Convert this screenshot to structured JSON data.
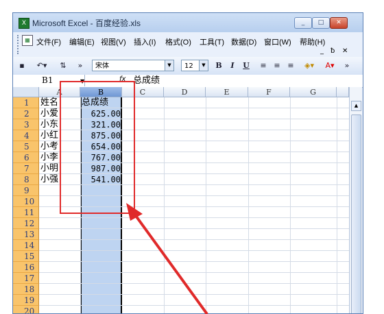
{
  "window": {
    "title": "Microsoft Excel - 百度经验.xls",
    "icon": "excel-icon"
  },
  "menu": [
    "文件(F)",
    "编辑(E)",
    "视图(V)",
    "插入(I)",
    "格式(O)",
    "工具(T)",
    "数据(D)",
    "窗口(W)",
    "帮助(H)"
  ],
  "toolbar": {
    "font": "宋体",
    "size": "12",
    "bold": "B",
    "italic": "I",
    "underline": "U"
  },
  "formula_bar": {
    "name_box": "B1",
    "fx": "fx",
    "content": "总成绩"
  },
  "columns": [
    "A",
    "B",
    "C",
    "D",
    "E",
    "F",
    "G"
  ],
  "rows": [
    "1",
    "2",
    "3",
    "4",
    "5",
    "6",
    "7",
    "8",
    "9",
    "10",
    "11",
    "12",
    "13",
    "14",
    "15",
    "16",
    "17",
    "18",
    "19",
    "20"
  ],
  "cells": [
    [
      "姓名",
      "总成绩"
    ],
    [
      "小爱",
      "625.00"
    ],
    [
      "小东",
      "321.00"
    ],
    [
      "小红",
      "875.00"
    ],
    [
      "小考",
      "654.00"
    ],
    [
      "小李",
      "767.00"
    ],
    [
      "小明",
      "987.00"
    ],
    [
      "小强",
      "541.00"
    ]
  ],
  "colors": {
    "selection": "#bed4f1",
    "row_header": "#f9c46b",
    "annotation": "#e02a2a"
  }
}
